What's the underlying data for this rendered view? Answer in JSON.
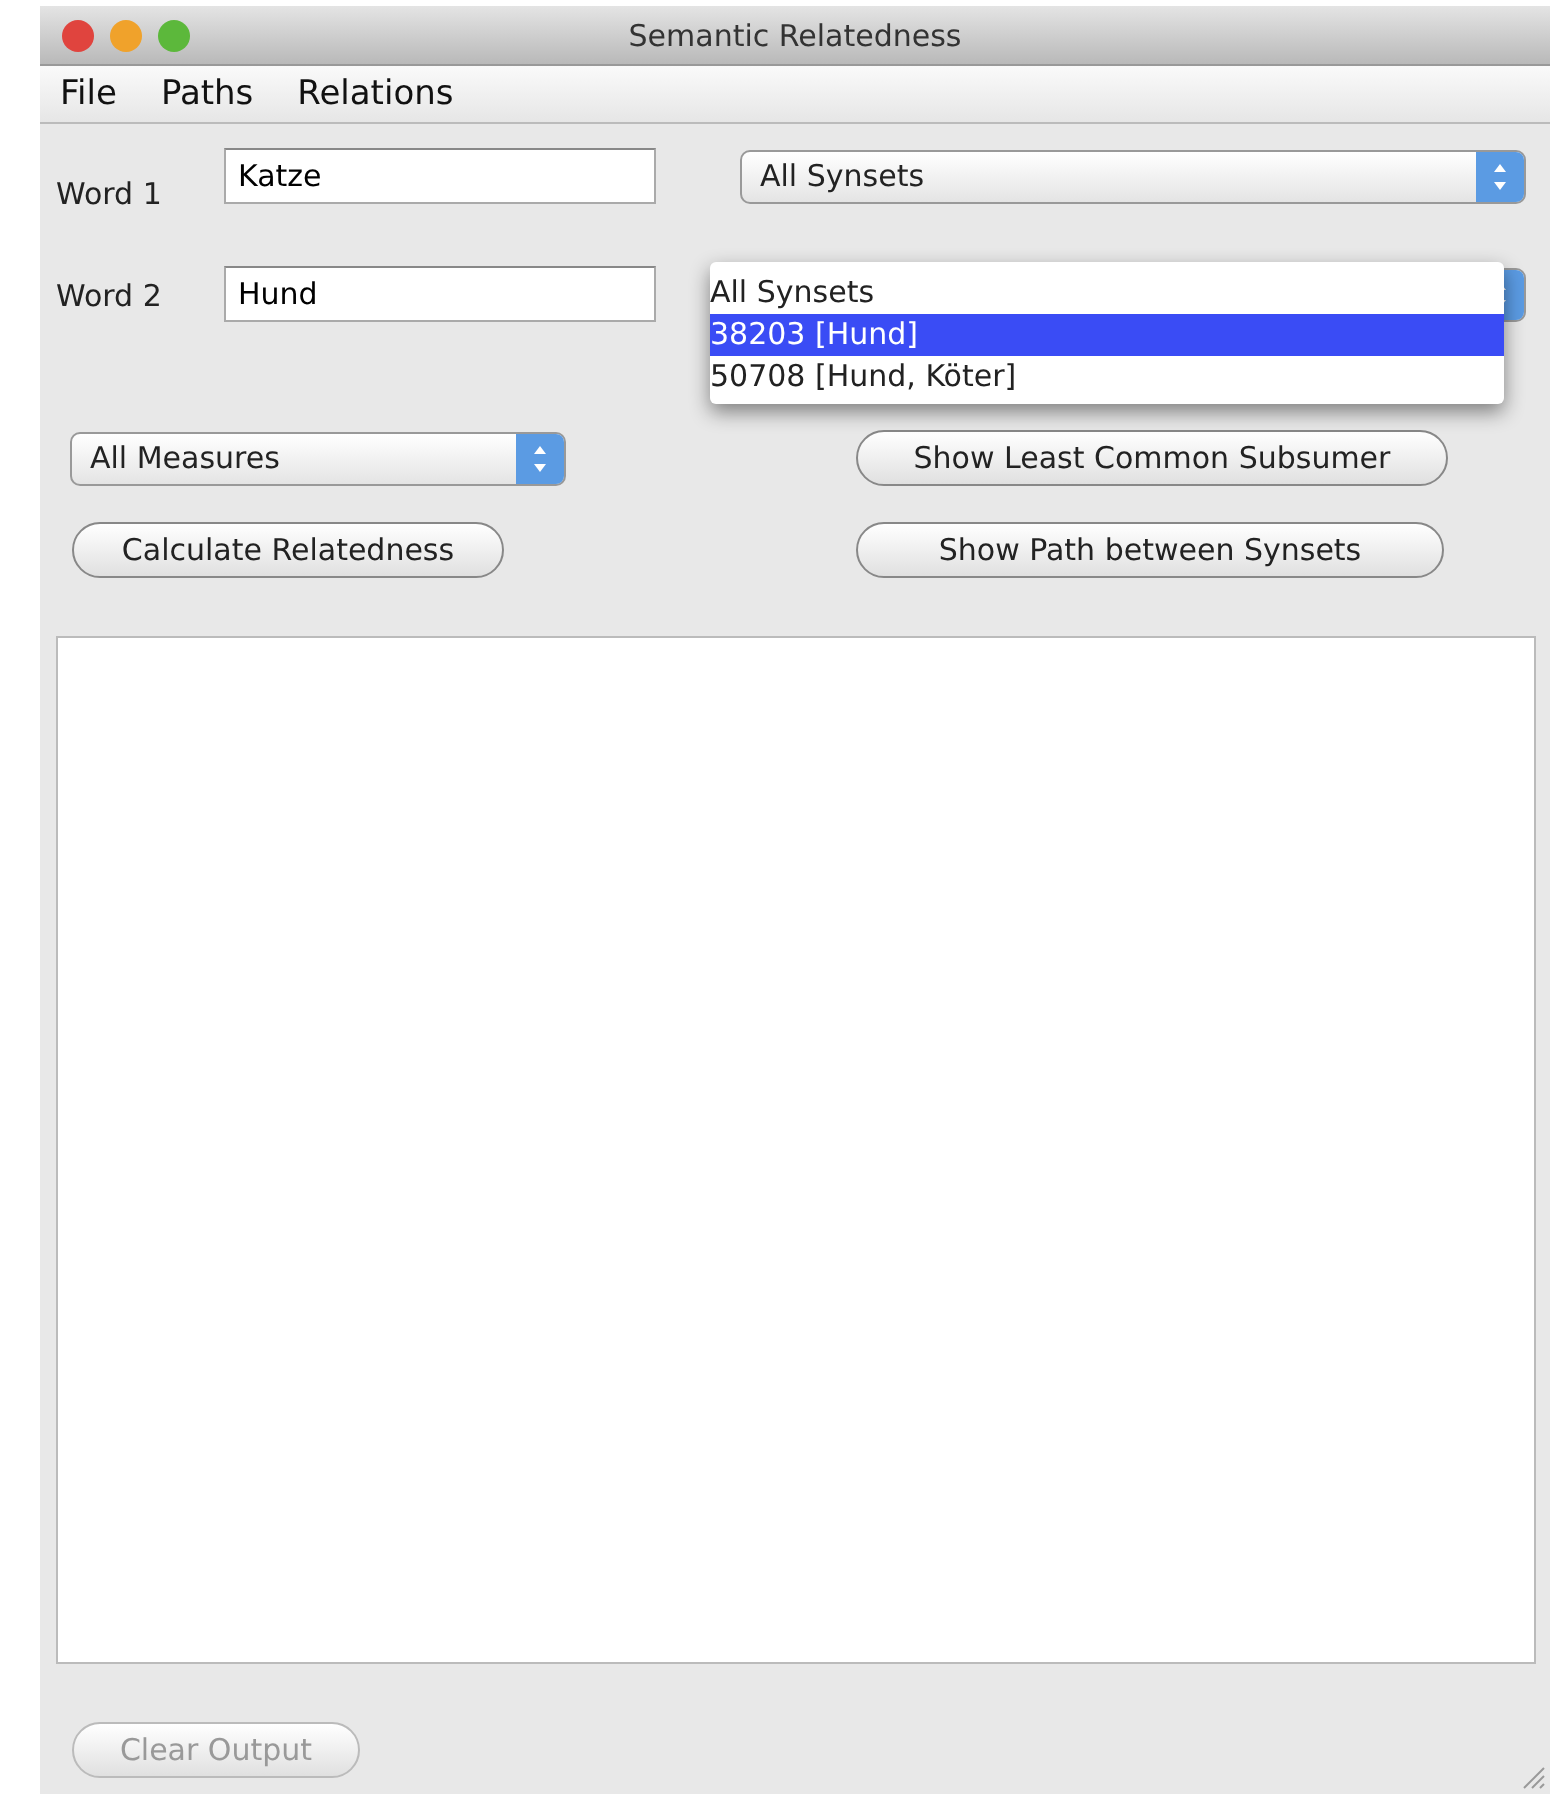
{
  "window": {
    "title": "Semantic Relatedness"
  },
  "menu": [
    "File",
    "Paths",
    "Relations"
  ],
  "words": [
    {
      "label": "Word 1",
      "value": "Katze",
      "synset": "All Synsets"
    },
    {
      "label": "Word 2",
      "value": "Hund",
      "synset_open": true
    }
  ],
  "synset_popup": [
    {
      "label": "All Synsets",
      "selected": false
    },
    {
      "label": "38203 [Hund]",
      "selected": true
    },
    {
      "label": "50708 [Hund, Köter]",
      "selected": false
    }
  ],
  "measure_select": "All Measures",
  "buttons": [
    {
      "label": "Calculate Relatedness",
      "disabled": false
    },
    {
      "label": "Show Least Common Subsumer",
      "disabled": false
    },
    {
      "label": "Show Path between Synsets",
      "disabled": false
    }
  ],
  "clear_button": {
    "label": "Clear Output",
    "disabled": true
  }
}
